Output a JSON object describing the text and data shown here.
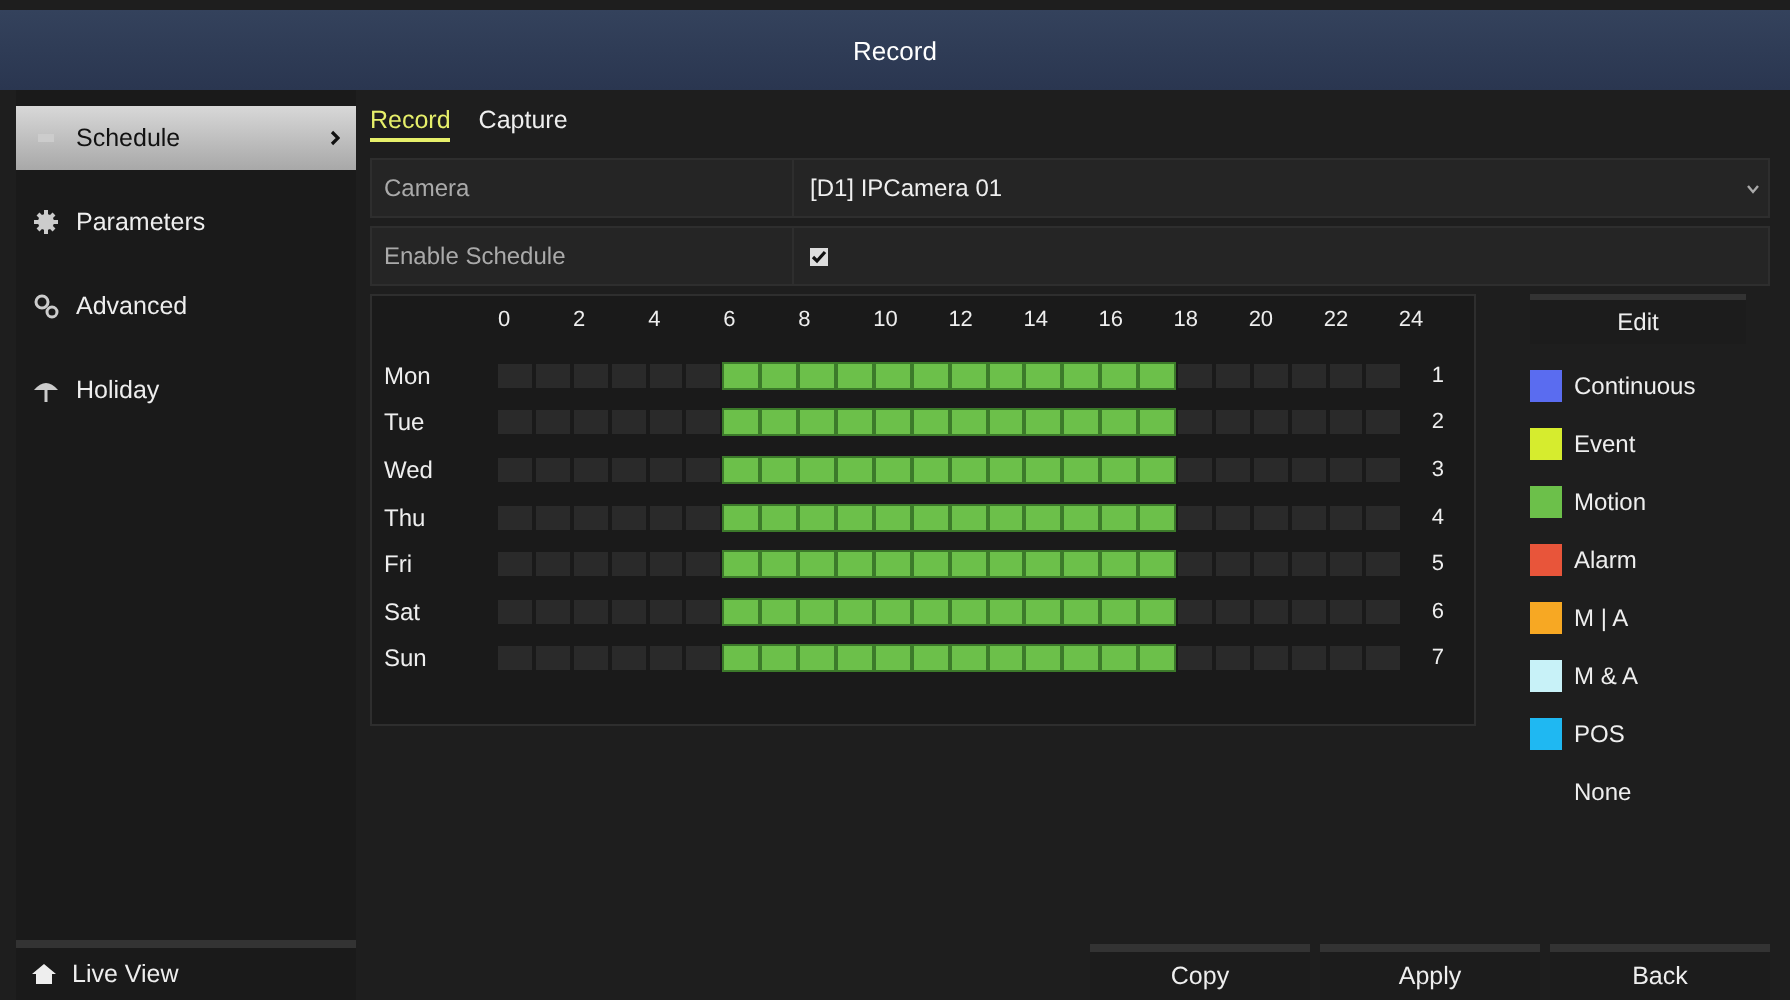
{
  "window": {
    "title": "Record"
  },
  "sidebar": {
    "items": [
      {
        "label": "Schedule",
        "selected": true
      },
      {
        "label": "Parameters",
        "selected": false
      },
      {
        "label": "Advanced",
        "selected": false
      },
      {
        "label": "Holiday",
        "selected": false
      }
    ],
    "footer": {
      "label": "Live View"
    }
  },
  "tabs": [
    {
      "label": "Record",
      "selected": true
    },
    {
      "label": "Capture",
      "selected": false
    }
  ],
  "camera": {
    "label": "Camera",
    "value": "[D1] IPCamera 01"
  },
  "enable_schedule": {
    "label": "Enable Schedule",
    "checked": true
  },
  "schedule": {
    "hours": [
      "0",
      "2",
      "4",
      "6",
      "8",
      "10",
      "12",
      "14",
      "16",
      "18",
      "20",
      "22",
      "24"
    ],
    "days": [
      {
        "label": "Mon",
        "number": "1",
        "color": "#6cc04a",
        "slots": [
          false,
          false,
          false,
          false,
          false,
          false,
          true,
          true,
          true,
          true,
          true,
          true,
          true,
          true,
          true,
          true,
          true,
          true,
          false,
          false,
          false,
          false,
          false,
          false
        ]
      },
      {
        "label": "Tue",
        "number": "2",
        "color": "#6cc04a",
        "slots": [
          false,
          false,
          false,
          false,
          false,
          false,
          true,
          true,
          true,
          true,
          true,
          true,
          true,
          true,
          true,
          true,
          true,
          true,
          false,
          false,
          false,
          false,
          false,
          false
        ]
      },
      {
        "label": "Wed",
        "number": "3",
        "color": "#6cc04a",
        "slots": [
          false,
          false,
          false,
          false,
          false,
          false,
          true,
          true,
          true,
          true,
          true,
          true,
          true,
          true,
          true,
          true,
          true,
          true,
          false,
          false,
          false,
          false,
          false,
          false
        ]
      },
      {
        "label": "Thu",
        "number": "4",
        "color": "#6cc04a",
        "slots": [
          false,
          false,
          false,
          false,
          false,
          false,
          true,
          true,
          true,
          true,
          true,
          true,
          true,
          true,
          true,
          true,
          true,
          true,
          false,
          false,
          false,
          false,
          false,
          false
        ]
      },
      {
        "label": "Fri",
        "number": "5",
        "color": "#6cc04a",
        "slots": [
          false,
          false,
          false,
          false,
          false,
          false,
          true,
          true,
          true,
          true,
          true,
          true,
          true,
          true,
          true,
          true,
          true,
          true,
          false,
          false,
          false,
          false,
          false,
          false
        ]
      },
      {
        "label": "Sat",
        "number": "6",
        "color": "#6cc04a",
        "slots": [
          false,
          false,
          false,
          false,
          false,
          false,
          true,
          true,
          true,
          true,
          true,
          true,
          true,
          true,
          true,
          true,
          true,
          true,
          false,
          false,
          false,
          false,
          false,
          false
        ]
      },
      {
        "label": "Sun",
        "number": "7",
        "color": "#6cc04a",
        "slots": [
          false,
          false,
          false,
          false,
          false,
          false,
          true,
          true,
          true,
          true,
          true,
          true,
          true,
          true,
          true,
          true,
          true,
          true,
          false,
          false,
          false,
          false,
          false,
          false
        ]
      }
    ]
  },
  "edit_button": "Edit",
  "legend": [
    {
      "label": "Continuous",
      "color": "#5a6cf0"
    },
    {
      "label": "Event",
      "color": "#d6ec2e"
    },
    {
      "label": "Motion",
      "color": "#6cc04a"
    },
    {
      "label": "Alarm",
      "color": "#e8553a"
    },
    {
      "label": "M | A",
      "color": "#f7a823"
    },
    {
      "label": "M & A",
      "color": "#c8f2f8"
    },
    {
      "label": "POS",
      "color": "#1fb8f2"
    },
    {
      "label": "None"
    }
  ],
  "buttons": [
    "Copy",
    "Apply",
    "Back"
  ]
}
